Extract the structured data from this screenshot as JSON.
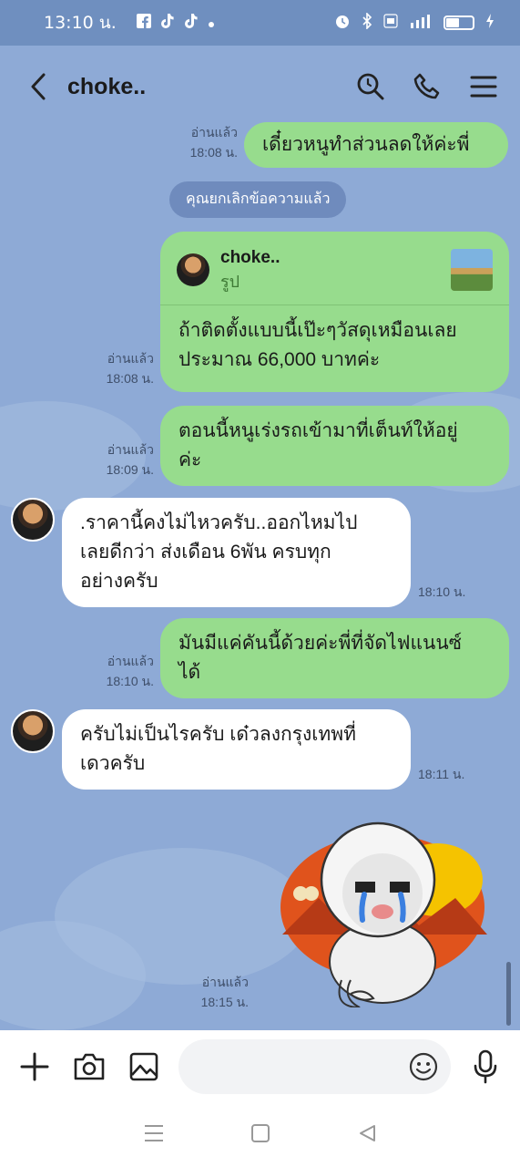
{
  "status_bar": {
    "time": "13:10 น.",
    "battery_level": 0.5
  },
  "header": {
    "contact_name": "choke.."
  },
  "messages": {
    "m1": {
      "text": "เดี๋ยวหนูทำส่วนลดให้ค่ะพี่",
      "read": "อ่านแล้ว",
      "time": "18:08 น."
    },
    "system": "คุณยกเลิกข้อความแล้ว",
    "m2": {
      "reply_name": "choke..",
      "reply_type": "รูป",
      "text_line1": "ถ้าติดตั้งแบบนี้เป๊ะๆวัสดุเหมือนเลย",
      "text_line2": "ประมาณ 66,000 บาทค่ะ",
      "read": "อ่านแล้ว",
      "time": "18:08 น."
    },
    "m3": {
      "text_line1": "ตอนนี้หนูเร่งรถเข้ามาที่เต็นท์ให้อยู่",
      "text_line2": "ค่ะ",
      "read": "อ่านแล้ว",
      "time": "18:09 น."
    },
    "m4": {
      "text_line1": ".ราคานี้คงไม่ไหวครับ..ออกไหมไป",
      "text_line2": "เลยดีกว่า ส่งเดือน 6พัน ครบทุก",
      "text_line3": "อย่างครับ",
      "time": "18:10 น."
    },
    "m5": {
      "text_line1": "มันมีแค่คันนี้ด้วยค่ะพี่ที่จัดไฟแนนซ์",
      "text_line2": "ได้",
      "read": "อ่านแล้ว",
      "time": "18:10 น."
    },
    "m6": {
      "text_line1": "ครับไม่เป็นไรครับ เด๋วลงกรุงเทพที่",
      "text_line2": "เดวครับ",
      "time": "18:11 น."
    },
    "m7": {
      "read": "อ่านแล้ว",
      "time": "18:15 น."
    }
  },
  "input": {
    "placeholder": ""
  },
  "colors": {
    "chat_bg": "#8eaad6",
    "outgoing_bubble": "#97dc8d",
    "incoming_bubble": "#ffffff"
  }
}
